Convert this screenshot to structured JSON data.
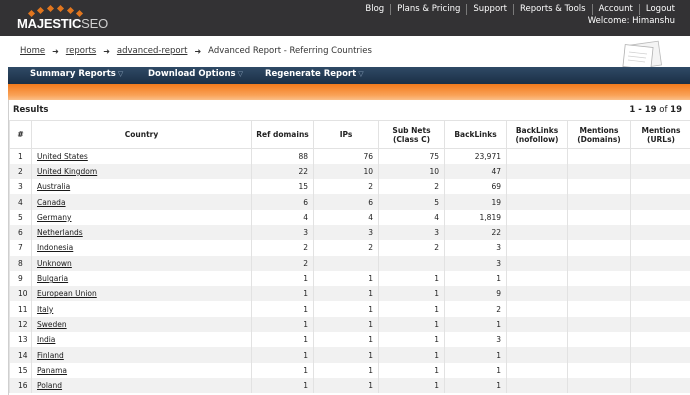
{
  "header": {
    "logo_main": "MAJESTIC",
    "logo_suffix": "SEO",
    "nav": [
      "Blog",
      "Plans & Pricing",
      "Support",
      "Reports & Tools",
      "Account",
      "Logout"
    ],
    "welcome": "Welcome: Himanshu",
    "colors": {
      "bar": "#333234",
      "accent": "#e2761e"
    }
  },
  "breadcrumb": {
    "items": [
      "Home",
      "reports",
      "advanced-report"
    ],
    "current": "Advanced Report - Referring Countries"
  },
  "menu": {
    "items": [
      "Summary Reports",
      "Download Options",
      "Regenerate Report"
    ],
    "colors": {
      "menubar": "#1f3650",
      "orange": "#f58a32"
    }
  },
  "results": {
    "title": "Results",
    "range": "1 - 19",
    "of": "of",
    "total": "19",
    "columns": [
      "#",
      "Country",
      "Ref domains",
      "IPs",
      "Sub Nets (Class C)",
      "BackLinks",
      "BackLinks (nofollow)",
      "Mentions (Domains)",
      "Mentions (URLs)"
    ],
    "rows": [
      {
        "n": "1",
        "country": "United States",
        "ref": "88",
        "ips": "76",
        "subnets": "75",
        "backlinks": "23,971"
      },
      {
        "n": "2",
        "country": "United Kingdom",
        "ref": "22",
        "ips": "10",
        "subnets": "10",
        "backlinks": "47"
      },
      {
        "n": "3",
        "country": "Australia",
        "ref": "15",
        "ips": "2",
        "subnets": "2",
        "backlinks": "69"
      },
      {
        "n": "4",
        "country": "Canada",
        "ref": "6",
        "ips": "6",
        "subnets": "5",
        "backlinks": "19"
      },
      {
        "n": "5",
        "country": "Germany",
        "ref": "4",
        "ips": "4",
        "subnets": "4",
        "backlinks": "1,819"
      },
      {
        "n": "6",
        "country": "Netherlands",
        "ref": "3",
        "ips": "3",
        "subnets": "3",
        "backlinks": "22"
      },
      {
        "n": "7",
        "country": "Indonesia",
        "ref": "2",
        "ips": "2",
        "subnets": "2",
        "backlinks": "3"
      },
      {
        "n": "8",
        "country": "Unknown",
        "ref": "2",
        "ips": "",
        "subnets": "",
        "backlinks": "3"
      },
      {
        "n": "9",
        "country": "Bulgaria",
        "ref": "1",
        "ips": "1",
        "subnets": "1",
        "backlinks": "1"
      },
      {
        "n": "10",
        "country": "European Union",
        "ref": "1",
        "ips": "1",
        "subnets": "1",
        "backlinks": "9"
      },
      {
        "n": "11",
        "country": "Italy",
        "ref": "1",
        "ips": "1",
        "subnets": "1",
        "backlinks": "2"
      },
      {
        "n": "12",
        "country": "Sweden",
        "ref": "1",
        "ips": "1",
        "subnets": "1",
        "backlinks": "1"
      },
      {
        "n": "13",
        "country": "India",
        "ref": "1",
        "ips": "1",
        "subnets": "1",
        "backlinks": "3"
      },
      {
        "n": "14",
        "country": "Finland",
        "ref": "1",
        "ips": "1",
        "subnets": "1",
        "backlinks": "1"
      },
      {
        "n": "15",
        "country": "Panama",
        "ref": "1",
        "ips": "1",
        "subnets": "1",
        "backlinks": "1"
      },
      {
        "n": "16",
        "country": "Poland",
        "ref": "1",
        "ips": "1",
        "subnets": "1",
        "backlinks": "1"
      }
    ]
  }
}
